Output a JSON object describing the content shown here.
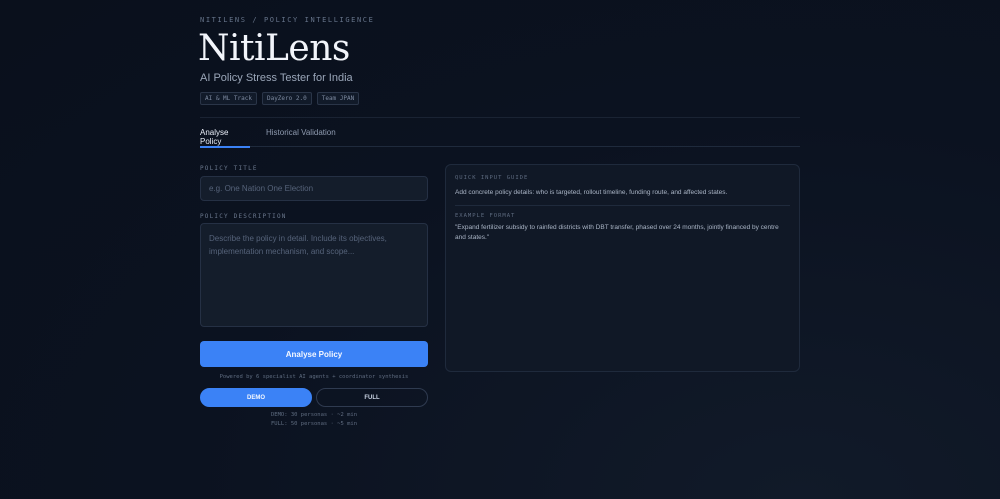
{
  "header": {
    "eyebrow": "NITILENS / POLICY INTELLIGENCE",
    "brand": "NitiLens",
    "tagline": "AI Policy Stress Tester for India",
    "badges": [
      "AI & ML Track",
      "DayZero 2.0",
      "Team JPAN"
    ]
  },
  "tabs": [
    {
      "label": "Analyse Policy",
      "active": true
    },
    {
      "label": "Historical Validation",
      "active": false
    }
  ],
  "form": {
    "title_label": "POLICY TITLE",
    "title_placeholder": "e.g. One Nation One Election",
    "title_value": "",
    "description_label": "POLICY DESCRIPTION",
    "description_placeholder": "Describe the policy in detail. Include its objectives, implementation mechanism, and scope...",
    "description_value": "",
    "submit_label": "Analyse Policy",
    "powered_text": "Powered by 6 specialist AI agents + coordinator synthesis",
    "modes": {
      "demo_label": "DEMO",
      "full_label": "FULL",
      "selected": "DEMO"
    },
    "notes": [
      "DEMO: 30 personas · ~2 min",
      "FULL: 50 personas · ~5 min"
    ]
  },
  "guide": {
    "label": "QUICK INPUT GUIDE",
    "text": "Add concrete policy details: who is targeted, rollout timeline, funding route, and affected states.",
    "example_label": "EXAMPLE FORMAT",
    "example_text": "\"Expand fertilizer subsidy to rainfed districts with DBT transfer, phased over 24 months, jointly financed by centre and states.\""
  },
  "colors": {
    "accent": "#3b82f6",
    "background": "#0b1220",
    "panel": "#101826"
  }
}
